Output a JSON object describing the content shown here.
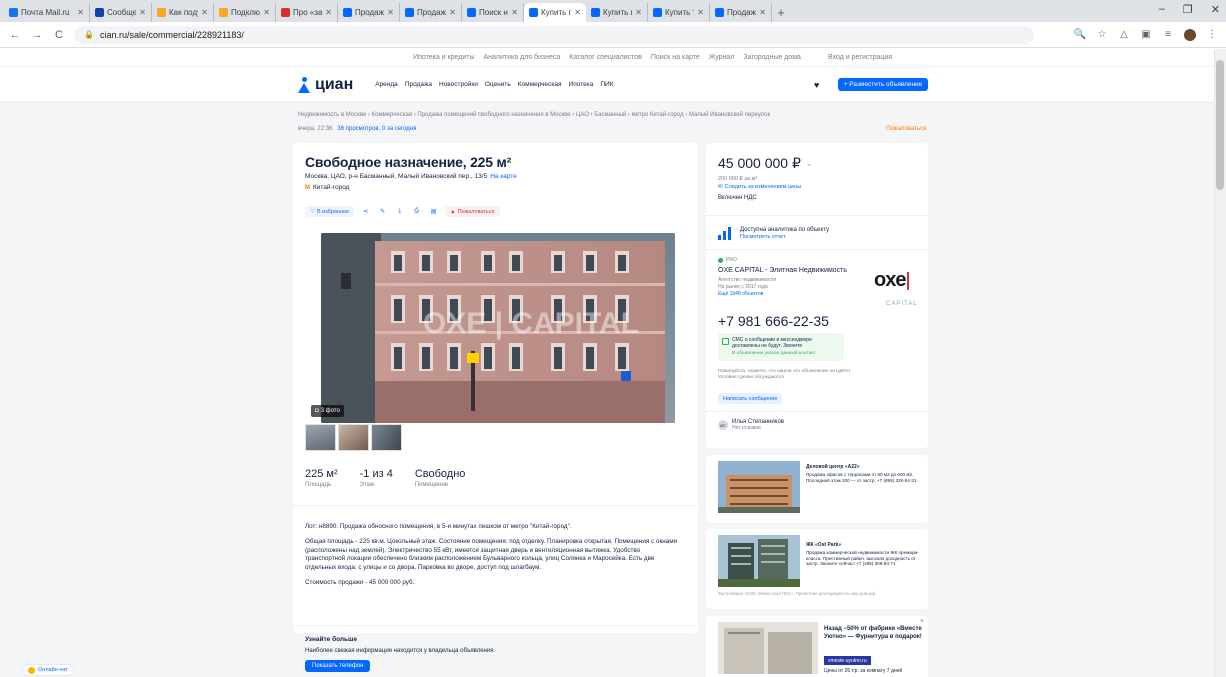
{
  "browser": {
    "tabs": [
      {
        "label": "Почта Mail.ru",
        "color": "#1a73e8"
      },
      {
        "label": "Сообщен",
        "color": "#0d47a1"
      },
      {
        "label": "Как подумат",
        "color": "#f9a825"
      },
      {
        "label": "Подключени",
        "color": "#f9a825"
      },
      {
        "label": "Про «забыть",
        "color": "#d32f2f"
      },
      {
        "label": "Продажа оф",
        "color": "#0468ff"
      },
      {
        "label": "Продажа пом",
        "color": "#0468ff"
      },
      {
        "label": "Поиск на кар",
        "color": "#0468ff"
      },
      {
        "label": "Купить поме",
        "color": "#0468ff",
        "active": true
      },
      {
        "label": "Купить поме",
        "color": "#0468ff"
      },
      {
        "label": "Купить торгс",
        "color": "#0468ff"
      },
      {
        "label": "Продажа офи",
        "color": "#0468ff"
      }
    ],
    "new_tab": "+",
    "window_controls": [
      "–",
      "❐",
      "✕"
    ],
    "url": "cian.ru/sale/commercial/228921183/",
    "nav_back": "←",
    "nav_forward": "→",
    "nav_reload": "C"
  },
  "promo_strip": {
    "items": [
      "Ипотека и кредиты",
      "Аналитика для бизнеса",
      "Каталог специалистов",
      "Поиск на карте",
      "Журнал",
      "Загородные дома"
    ],
    "login": "Вход и регистрация"
  },
  "header": {
    "logo": "циан",
    "nav": [
      "Аренда",
      "Продажа",
      "Новостройки",
      "Оценить",
      "Коммерческая",
      "Ипотека",
      "ПИК"
    ],
    "place_ad": "+ Разместить объявление"
  },
  "breadcrumb": "Недвижимость в Москве › Коммерческая › Продажа помещений свободного назначения в Москве › ЦАО › Басманный › метро Китай-город › Малый Ивановский переулок",
  "meta": {
    "updated": "вчера, 22:36",
    "views": "36 просмотров, 0 за сегодня"
  },
  "complain": "Пожаловаться",
  "listing": {
    "title": "Свободное назначение, 225 м²",
    "address": "Москва, ЦАО, р-н Басманный, Малый Ивановский пер., 13/5",
    "map_link": "На карте",
    "metro": "Китай-город",
    "actions": {
      "favorite": "В избранное",
      "report": "Пожаловаться"
    },
    "photo_count": "3 фото",
    "watermark": "OXE | CAPITAL",
    "stats": [
      {
        "value": "225 м²",
        "label": "Площадь"
      },
      {
        "value": "-1 из 4",
        "label": "Этаж"
      },
      {
        "value": "Свободно",
        "label": "Помещение"
      }
    ],
    "description": [
      "Лот: н8890. Продажа обносного помещения, в 5-и минутах пешком от метро \"Китай-город\".",
      "Общая площадь - 225 кв.м. Цокольный этаж. Состояние помещения: под отделку. Планировка открытая. Помещения с окнами (расположены над землей). Электричество 55 кВт, имеется защитная дверь и вентиляционная вытяжка. Удобство транспортной локации обеспечено близким расположением Бульварного кольца, улиц Солянка и Маросейка. Есть две отдельных входа: с улицы и со двора. Парковка во дворе, доступ под шлагбаум.",
      "Стоимость продажи - 45 000 000 руб."
    ],
    "more": {
      "title": "Узнайте больше",
      "text": "Наиболее свежая информация находится у владельца объявления.",
      "button": "Показать телефон"
    }
  },
  "price": {
    "value": "45 000 000 ₽",
    "per_meter": "200 000 ₽ за м²",
    "subscribe": "Следить за изменением цены",
    "vat": "Включен НДС"
  },
  "analytics": {
    "title": "Доступна аналитика по объекту",
    "link": "Посмотреть отчет"
  },
  "agency": {
    "badge": "PRO",
    "name": "OXE CAPITAL - Элитная Недвижимость",
    "type": "Агентство недвижимости",
    "since": "На рынке с 2017 года",
    "all_link": "Ещё 1948 объектов",
    "logo": "oxe",
    "logo_sub": "CAPITAL",
    "phone": "+7 981 666-22-35",
    "notice_1": "СМС о сообщении в мессенджере доставлены не будут. Звоните",
    "notice_2": "В объявлении указан данный контакт",
    "tell_text": "Пожалуйста, скажите, что нашли это объявление на ЦИАН. Условия сделки обсуждаются",
    "write_btn": "Написать сообщение",
    "agent_initials": "ИС",
    "agent_name": "Илья Степанников",
    "agent_reviews": "Нет отзывов"
  },
  "ads": [
    {
      "title": "Деловой центр «А22»",
      "text": "Продажа офисов с террасами от 60 м2 до 600 м2. Последний этаж 200 — от застр. +7 (895) 328-54-31",
      "foot": ""
    },
    {
      "title": "ЖК «Ost Park»",
      "text": "Продажа коммерческой недвижимости ЖК премиум-класса. Престижный район, высокая доходность от застр. Звоните сейчас! +7 (495) 308-84-71",
      "foot": "Застройщик: ООО «Инвестрой ПКС». Проектная декларация на наш.дом.рф"
    },
    {
      "title": "Назад −50% от фабрики «Вместе Уютно» — Фурнитура в подарок!",
      "button": "vmeste-uyutno.ru",
      "price": "Цены от 26 т.р. за комнату 7 дней",
      "close": "×"
    }
  ],
  "chat": "Онлайн-чат"
}
